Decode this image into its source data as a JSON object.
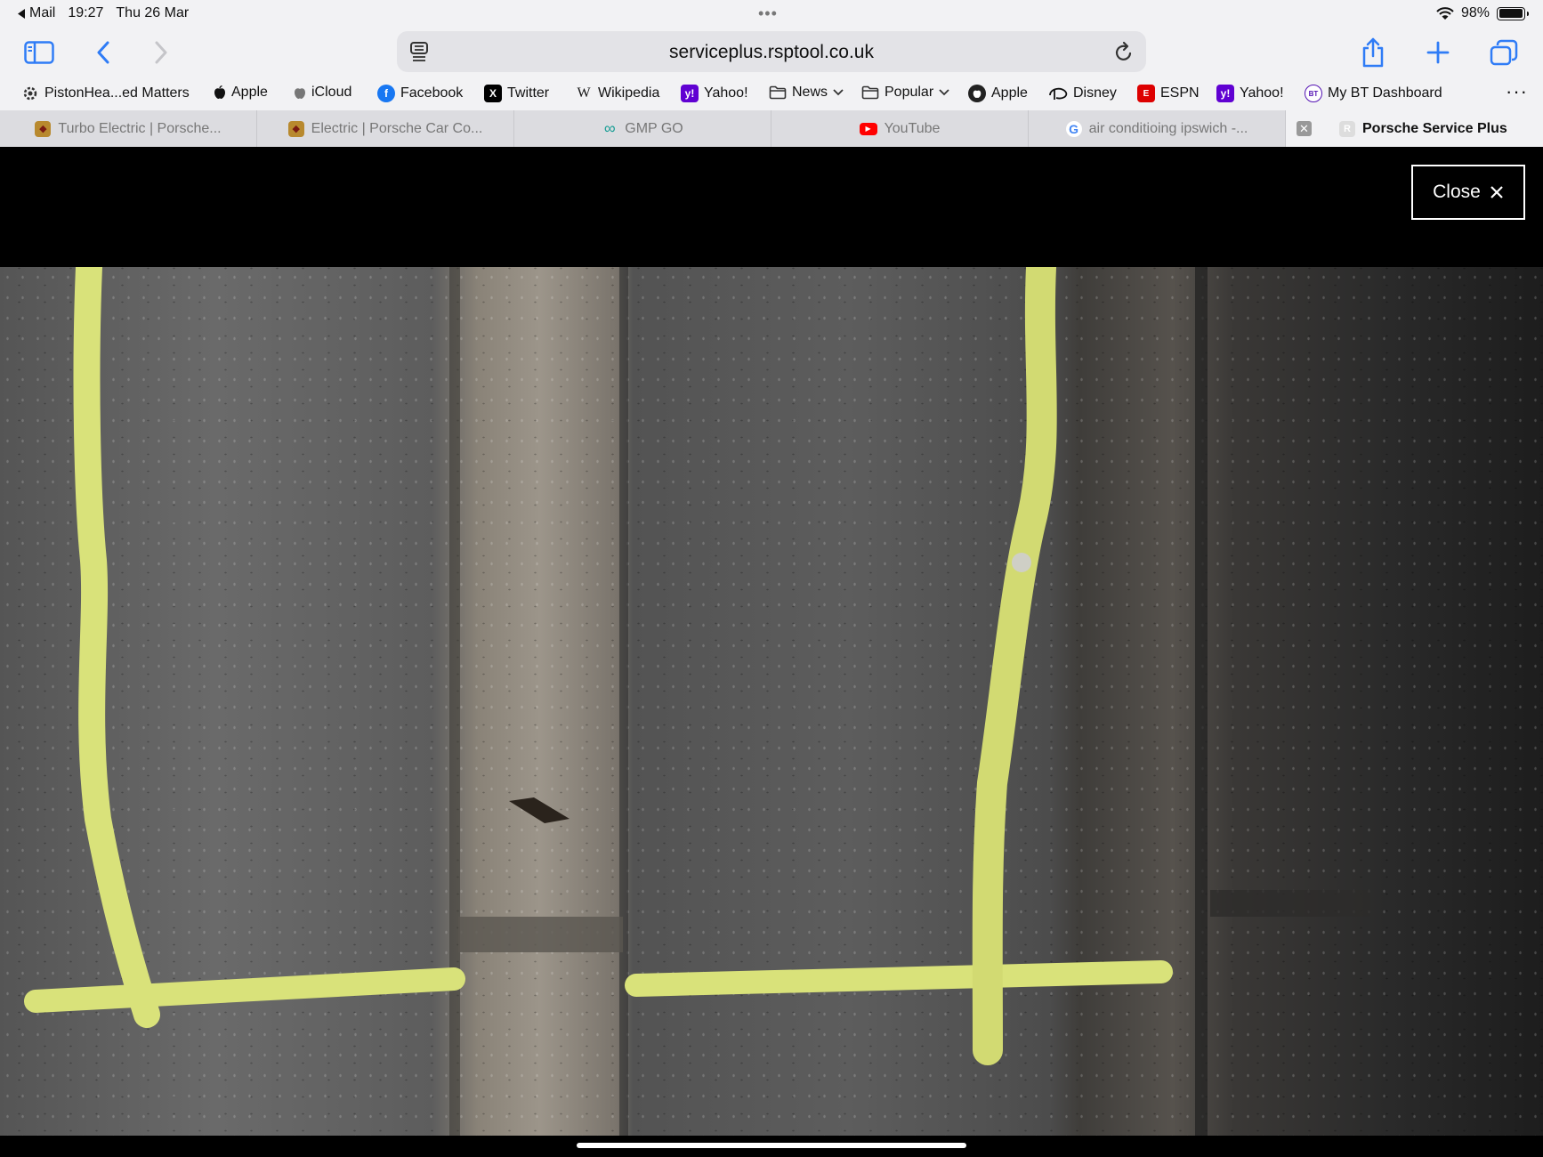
{
  "status": {
    "back_app": "Mail",
    "time": "19:27",
    "date": "Thu 26 Mar",
    "battery_text": "98%",
    "battery_level": 0.98
  },
  "toolbar": {
    "url": "serviceplus.rsptool.co.uk"
  },
  "bookmarks": [
    {
      "label": "PistonHea...ed Matters",
      "icon": "gear-icon"
    },
    {
      "label": "Apple",
      "icon": "apple-icon"
    },
    {
      "label": "iCloud",
      "icon": "apple-icon"
    },
    {
      "label": "Facebook",
      "icon": "facebook-icon"
    },
    {
      "label": "Twitter",
      "icon": "x-icon"
    },
    {
      "label": "Wikipedia",
      "icon": "wikipedia-icon"
    },
    {
      "label": "Yahoo!",
      "icon": "yahoo-icon"
    },
    {
      "label": "News",
      "icon": "folder-icon"
    },
    {
      "label": "Popular",
      "icon": "folder-icon"
    },
    {
      "label": "Apple",
      "icon": "apple-icon"
    },
    {
      "label": "Disney",
      "icon": "disney-icon"
    },
    {
      "label": "ESPN",
      "icon": "espn-icon"
    },
    {
      "label": "Yahoo!",
      "icon": "yahoo-icon"
    },
    {
      "label": "My BT Dashboard",
      "icon": "bt-icon"
    }
  ],
  "tabs": [
    {
      "label": "Turbo Electric | Porsche...",
      "icon": "porsche-crest-icon"
    },
    {
      "label": "Electric | Porsche Car Co...",
      "icon": "porsche-crest-icon"
    },
    {
      "label": "GMP GO",
      "icon": "infinity-icon"
    },
    {
      "label": "YouTube",
      "icon": "youtube-icon"
    },
    {
      "label": "air conditioing ipswich -...",
      "icon": "google-icon"
    },
    {
      "label": "Porsche Service Plus",
      "icon": "r-icon",
      "active": true
    }
  ],
  "viewer": {
    "close_label": "Close"
  },
  "colors": {
    "chrome_bg": "#f2f2f4",
    "tab_strip_bg": "#dcdce0",
    "accent": "#2f7cf6",
    "tyre_marking": "#d9e27a"
  }
}
